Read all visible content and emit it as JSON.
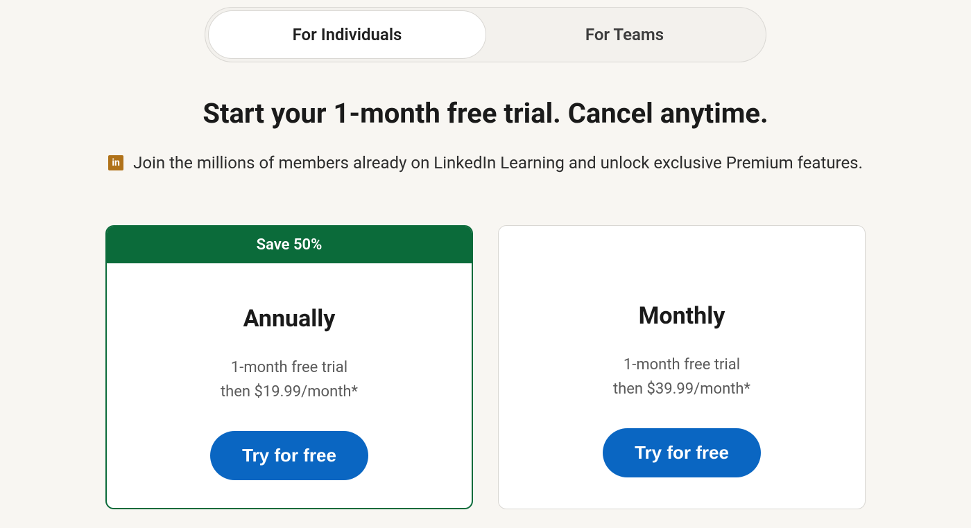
{
  "tabs": {
    "individuals": "For Individuals",
    "teams": "For Teams"
  },
  "headline": "Start your 1-month free trial. Cancel anytime.",
  "subtext": "Join the millions of members already on LinkedIn Learning and unlock exclusive Premium features.",
  "linkedin_badge_text": "in",
  "plans": {
    "annual": {
      "save_label": "Save 50%",
      "title": "Annually",
      "line1": "1-month free trial",
      "line2": "then $19.99/month*",
      "cta": "Try for free"
    },
    "monthly": {
      "title": "Monthly",
      "line1": "1-month free trial",
      "line2": "then $39.99/month*",
      "cta": "Try for free"
    }
  },
  "colors": {
    "accent_green": "#0b6b3a",
    "accent_blue": "#0a66c2",
    "linkedin_gold": "#b07219",
    "page_bg": "#f8f6f2"
  }
}
